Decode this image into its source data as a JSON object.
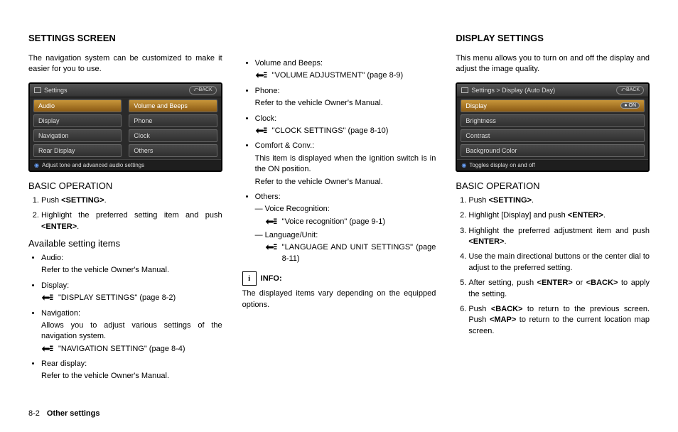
{
  "col1": {
    "title": "SETTINGS SCREEN",
    "intro": "The navigation system can be customized to make it easier for you to use.",
    "screen": {
      "title": "Settings",
      "back": "BACK",
      "left": [
        "Audio",
        "Display",
        "Navigation",
        "Rear Display"
      ],
      "right": [
        "Volume and Beeps",
        "Phone",
        "Clock",
        "Others"
      ],
      "footer": "Adjust tone and advanced audio settings"
    },
    "basic_head": "BASIC OPERATION",
    "steps": {
      "s1a": "Push ",
      "s1b": "<SETTING>",
      "s1c": ".",
      "s2a": "Highlight the preferred setting item and push ",
      "s2b": "<ENTER>",
      "s2c": "."
    },
    "avail_head": "Available setting items",
    "items": {
      "audio_h": "Audio:",
      "audio_t": "Refer to the vehicle Owner's Manual.",
      "disp_h": "Display:",
      "disp_ref": "\"DISPLAY SETTINGS\" (page 8-2)",
      "nav_h": "Navigation:",
      "nav_t": "Allows you to adjust various settings of the navigation system.",
      "nav_ref": "\"NAVIGATION SETTING\" (page 8-4)",
      "rear_h": "Rear display:",
      "rear_t": "Refer to the vehicle Owner's Manual."
    }
  },
  "col2": {
    "items": {
      "vb_h": "Volume and Beeps:",
      "vb_ref": "\"VOLUME ADJUSTMENT\" (page 8-9)",
      "ph_h": "Phone:",
      "ph_t": "Refer to the vehicle Owner's Manual.",
      "ck_h": "Clock:",
      "ck_ref": "\"CLOCK SETTINGS\" (page 8-10)",
      "cc_h": "Comfort & Conv.:",
      "cc_t1": "This item is displayed when the ignition switch is in the ON position.",
      "cc_t2": "Refer to the vehicle Owner's Manual.",
      "ot_h": "Others:",
      "ot_vr_h": "Voice Recognition:",
      "ot_vr_ref": "\"Voice recognition\" (page 9-1)",
      "ot_lu_h": "Language/Unit:",
      "ot_lu_ref": "\"LANGUAGE AND UNIT SETTINGS\" (page 8-11)"
    },
    "info_label": "INFO:",
    "info_text": "The displayed items vary depending on the equipped options."
  },
  "col3": {
    "title": "DISPLAY SETTINGS",
    "intro": "This menu allows you to turn on and off the display and adjust the image quality.",
    "screen": {
      "title": "Settings > Display (Auto Day)",
      "back": "BACK",
      "rows": [
        "Display",
        "Brightness",
        "Contrast",
        "Background Color"
      ],
      "on": "ON",
      "footer": "Toggles display on and off"
    },
    "basic_head": "BASIC OPERATION",
    "steps": {
      "s1a": "Push ",
      "s1b": "<SETTING>",
      "s1c": ".",
      "s2a": "Highlight [Display] and push ",
      "s2b": "<ENTER>",
      "s2c": ".",
      "s3a": "Highlight the preferred adjustment item and push ",
      "s3b": "<ENTER>",
      "s3c": ".",
      "s4": "Use the main directional buttons or the center dial to adjust to the preferred setting.",
      "s5a": "After setting, push ",
      "s5b": "<ENTER>",
      "s5c": " or ",
      "s5d": "<BACK>",
      "s5e": " to apply the setting.",
      "s6a": "Push ",
      "s6b": "<BACK>",
      "s6c": " to return to the previous screen. Push ",
      "s6d": "<MAP>",
      "s6e": " to return to the current location map screen."
    }
  },
  "footer": {
    "num": "8-2",
    "text": "Other settings"
  }
}
